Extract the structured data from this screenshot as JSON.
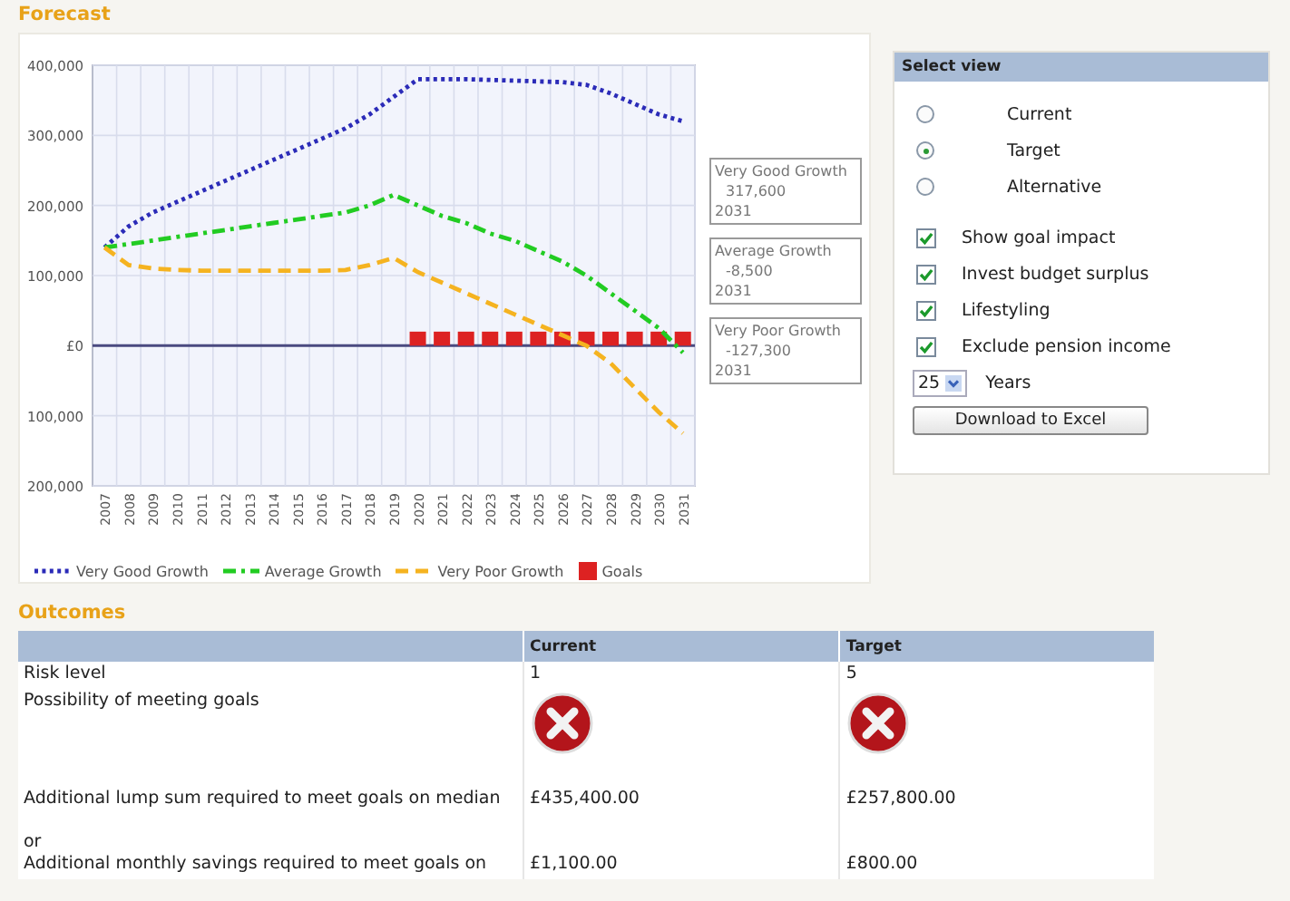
{
  "forecast": {
    "title": "Forecast",
    "chart_data": {
      "type": "line",
      "categories": [
        "2007",
        "2008",
        "2009",
        "2010",
        "2011",
        "2012",
        "2013",
        "2014",
        "2015",
        "2016",
        "2017",
        "2018",
        "2019",
        "2020",
        "2021",
        "2022",
        "2023",
        "2024",
        "2025",
        "2026",
        "2027",
        "2028",
        "2029",
        "2030",
        "2031"
      ],
      "ylim": [
        -200000,
        400000
      ],
      "grid": true,
      "legend": true,
      "ref_lines": [
        {
          "axis": "y",
          "value": 0,
          "color": "#4a4a80"
        }
      ],
      "yticks": [
        {
          "value": 400000,
          "label": "400,000"
        },
        {
          "value": 300000,
          "label": "300,000"
        },
        {
          "value": 200000,
          "label": "200,000"
        },
        {
          "value": 100000,
          "label": "100,000"
        },
        {
          "value": 0,
          "label": "£0"
        },
        {
          "value": -100000,
          "label": "100,000"
        },
        {
          "value": -200000,
          "label": "200,000"
        }
      ],
      "series": [
        {
          "name": "Very Good Growth",
          "color": "#2b2bb8",
          "line_style": "dotted",
          "values": [
            140000,
            170000,
            190000,
            205000,
            220000,
            235000,
            250000,
            265000,
            280000,
            295000,
            310000,
            330000,
            355000,
            380000,
            380000,
            380000,
            379000,
            378000,
            377000,
            376000,
            372000,
            360000,
            345000,
            330000,
            320000
          ]
        },
        {
          "name": "Average Growth",
          "color": "#22cc22",
          "line_style": "dashdot",
          "values": [
            140000,
            145000,
            150000,
            155000,
            160000,
            165000,
            170000,
            175000,
            180000,
            185000,
            190000,
            200000,
            215000,
            200000,
            185000,
            175000,
            160000,
            150000,
            135000,
            120000,
            100000,
            75000,
            50000,
            25000,
            -10000
          ]
        },
        {
          "name": "Very Poor Growth",
          "color": "#f5b320",
          "line_style": "dashed",
          "values": [
            140000,
            115000,
            110000,
            108000,
            107000,
            107000,
            107000,
            107000,
            107000,
            107000,
            108000,
            115000,
            125000,
            105000,
            90000,
            75000,
            60000,
            45000,
            30000,
            15000,
            0,
            -25000,
            -60000,
            -95000,
            -125000
          ]
        },
        {
          "name": "Goals",
          "color": "#dd2222",
          "type": "bar",
          "values": [
            null,
            null,
            null,
            null,
            null,
            null,
            null,
            null,
            null,
            null,
            null,
            null,
            null,
            20000,
            20000,
            20000,
            20000,
            20000,
            20000,
            20000,
            20000,
            20000,
            20000,
            20000,
            20000
          ]
        }
      ]
    },
    "callouts": [
      {
        "series": "Very Good Growth",
        "value": "317,600",
        "year": "2031"
      },
      {
        "series": "Average Growth",
        "value": "-8,500",
        "year": "2031"
      },
      {
        "series": "Very Poor Growth",
        "value": "-127,300",
        "year": "2031"
      }
    ]
  },
  "select_view": {
    "title": "Select view",
    "radios": [
      {
        "label": "Current",
        "selected": false
      },
      {
        "label": "Target",
        "selected": true
      },
      {
        "label": "Alternative",
        "selected": false
      }
    ],
    "checkboxes": [
      {
        "label": "Show goal impact",
        "checked": true
      },
      {
        "label": "Invest budget surplus",
        "checked": true
      },
      {
        "label": "Lifestyling",
        "checked": true
      },
      {
        "label": "Exclude pension income",
        "checked": true
      }
    ],
    "years": {
      "value": "25",
      "label": "Years"
    },
    "button": "Download to Excel"
  },
  "outcomes": {
    "title": "Outcomes",
    "columns": [
      "Current",
      "Target"
    ],
    "rows": [
      {
        "label": "Risk level",
        "cells": [
          {
            "kind": "text",
            "text": "1"
          },
          {
            "kind": "text",
            "text": "5"
          }
        ]
      },
      {
        "label": "Possibility of meeting goals",
        "cells": [
          {
            "kind": "status",
            "met": false
          },
          {
            "kind": "status",
            "met": false
          }
        ]
      },
      {
        "label": "Additional lump sum required to meet goals on median",
        "cells": [
          {
            "kind": "text",
            "text": "£435,400.00"
          },
          {
            "kind": "text",
            "text": "£257,800.00"
          }
        ]
      },
      {
        "label": "or",
        "cells": []
      },
      {
        "label": "Additional monthly savings required to meet goals on",
        "cells": [
          {
            "kind": "text",
            "text": "£1,100.00"
          },
          {
            "kind": "text",
            "text": "£800.00"
          }
        ]
      }
    ]
  }
}
